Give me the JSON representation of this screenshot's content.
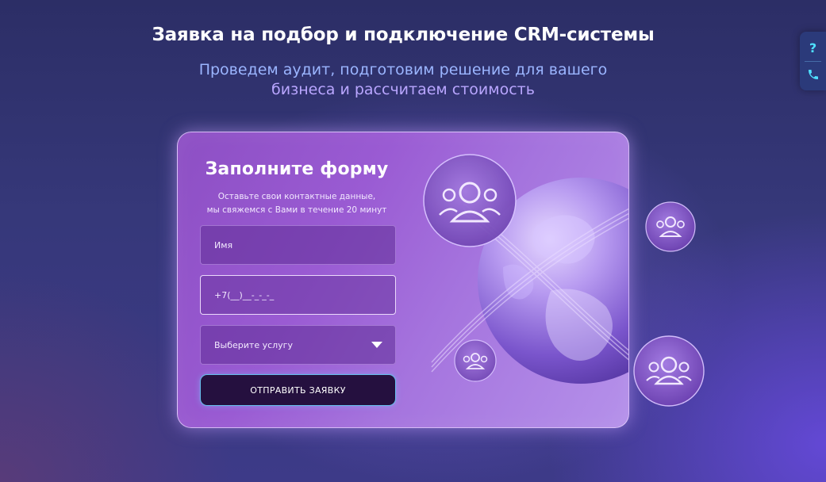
{
  "header": {
    "title": "Заявка на подбор и подключение CRM-системы",
    "subtitle_line1": "Проведем аудит, подготовим решение для вашего",
    "subtitle_line2": "бизнеса и рассчитаем стоимость"
  },
  "side_widget": {
    "help_icon": "question-icon",
    "help_glyph": "?",
    "phone_icon": "phone-icon",
    "phone_glyph": "✆"
  },
  "form": {
    "title": "Заполните форму",
    "description_line1": "Оставьте свои контактные данные,",
    "description_line2": "мы свяжемся с Вами в течение 20 минут",
    "name_placeholder": "Имя",
    "phone_value": "+7(__)__-_-_-_",
    "service_placeholder": "Выберите услугу",
    "submit_label": "ОТПРАВИТЬ ЗАЯВКУ"
  },
  "illustration": {
    "globe_icon": "globe-icon",
    "people_icon": "users-group-icon"
  },
  "colors": {
    "accent_cyan": "#4fe0ff",
    "card_purple": "#9a5bd3",
    "button_dark": "#25103f",
    "subtitle_blue": "#9bb5ff"
  }
}
